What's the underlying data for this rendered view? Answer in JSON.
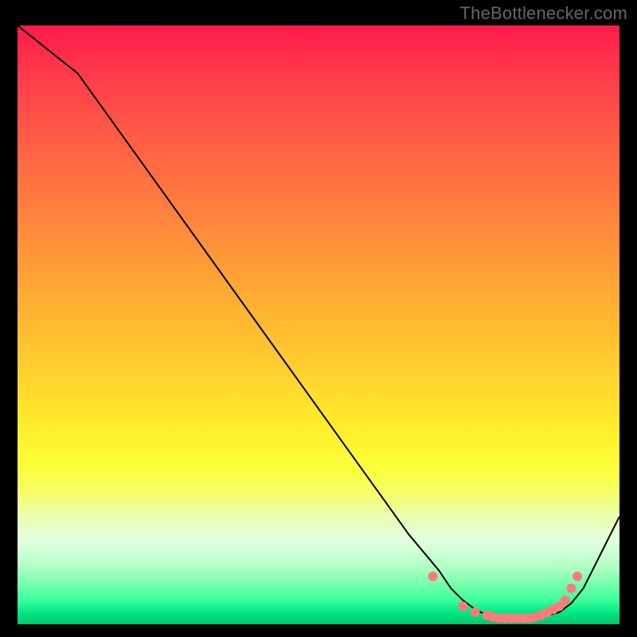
{
  "attribution": "TheBottlenecker.com",
  "chart_data": {
    "type": "line",
    "title": "",
    "xlabel": "",
    "ylabel": "",
    "ylim": [
      0,
      100
    ],
    "x": [
      0,
      5,
      10,
      15,
      20,
      25,
      30,
      35,
      40,
      45,
      50,
      55,
      60,
      65,
      70,
      72,
      74,
      76,
      78,
      80,
      82,
      84,
      86,
      88,
      90,
      92,
      94,
      96,
      98,
      100
    ],
    "values": [
      100,
      96,
      92,
      85,
      78,
      71,
      64,
      57,
      50,
      43,
      36,
      29,
      22,
      15,
      9,
      6,
      4,
      2.5,
      1.5,
      1,
      1,
      1,
      1,
      1.5,
      2,
      3.5,
      6,
      10,
      14,
      18
    ],
    "markers": {
      "x": [
        69,
        74,
        76,
        78,
        79,
        80,
        81,
        82,
        83,
        84,
        85,
        86,
        87,
        88,
        89,
        90,
        91,
        92,
        93
      ],
      "y": [
        8,
        3,
        2,
        1.5,
        1.2,
        1,
        1,
        1,
        1,
        1,
        1,
        1.2,
        1.5,
        2,
        2.5,
        3,
        4,
        6,
        8
      ],
      "color": "#ff7a7a"
    },
    "curve_color": "#000000",
    "background": "gradient-red-yellow-green-vertical"
  }
}
